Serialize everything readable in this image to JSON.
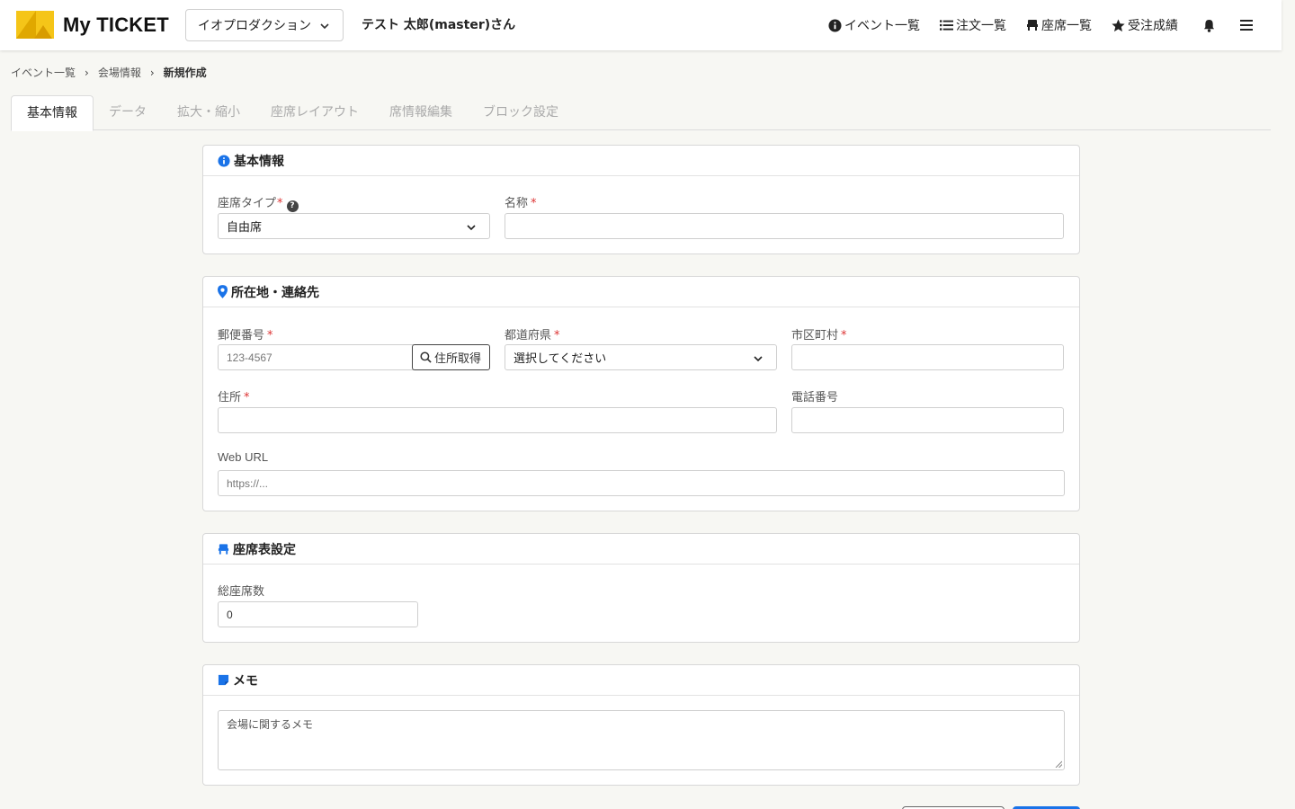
{
  "app": {
    "title": "My TICKET"
  },
  "header": {
    "org": "イオプロダクション",
    "user": "テスト 太郎(master)さん",
    "nav": [
      {
        "label": "イベント一覧",
        "icon": "info-circle-icon"
      },
      {
        "label": "注文一覧",
        "icon": "list-icon"
      },
      {
        "label": "座席一覧",
        "icon": "seat-icon"
      },
      {
        "label": "受注成績",
        "icon": "star-icon"
      }
    ]
  },
  "breadcrumb": [
    "イベント一覧",
    "会場情報",
    "新規作成"
  ],
  "tabs": [
    "基本情報",
    "データ",
    "拡大・縮小",
    "座席レイアウト",
    "席情報編集",
    "ブロック設定"
  ],
  "basic": {
    "title": "基本情報",
    "seat_type_label": "座席タイプ",
    "seat_type_value": "自由席",
    "name_label": "名称",
    "name_value": ""
  },
  "location": {
    "title": "所在地・連絡先",
    "postal_label": "郵便番号",
    "postal_placeholder": "123-4567",
    "address_lookup_label": "住所取得",
    "prefecture_label": "都道府県",
    "prefecture_value": "選択してください",
    "city_label": "市区町村",
    "address_label": "住所",
    "phone_label": "電話番号",
    "url_label": "Web URL",
    "url_placeholder": "https://..."
  },
  "seating": {
    "title": "座席表設定",
    "total_label": "総座席数",
    "total_value": "0"
  },
  "memo": {
    "title": "メモ",
    "placeholder": "会場に関するメモ"
  },
  "colors": {
    "accent": "#1a73e8",
    "logo": "#f5c518",
    "required": "#dd3333"
  }
}
